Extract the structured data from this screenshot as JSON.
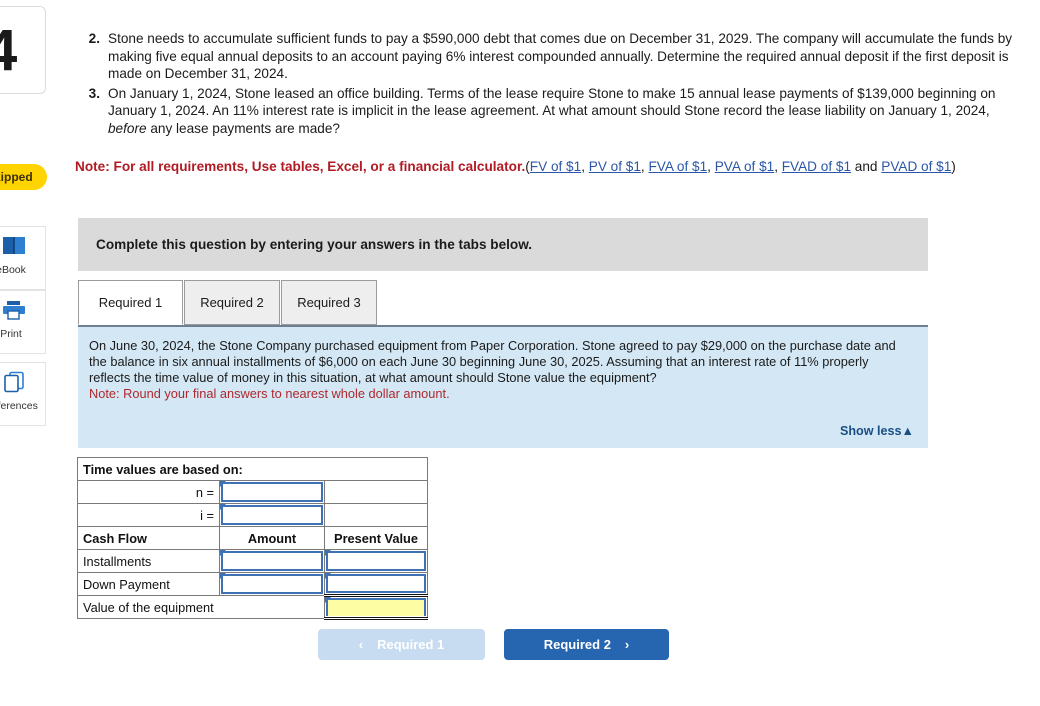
{
  "left_rail": {
    "question_number": "4",
    "status_badge": "Skipped",
    "tools": [
      {
        "icon": "ebook-icon",
        "label": "eBook"
      },
      {
        "icon": "print-icon",
        "label": "Print"
      },
      {
        "icon": "references-icon",
        "label": "References"
      }
    ]
  },
  "requirements": [
    {
      "number": "2.",
      "text_before_em": "Stone needs to accumulate sufficient funds to pay a $590,000 debt that comes due on December 31, 2029. The company will accumulate the funds by making five equal annual deposits to an account paying 6% interest compounded annually. Determine the required annual deposit if the first deposit is made on December 31, 2024.",
      "em": "",
      "text_after_em": ""
    },
    {
      "number": "3.",
      "text_before_em": "On January 1, 2024, Stone leased an office building. Terms of the lease require Stone to make 15 annual lease payments of $139,000 beginning on January 1, 2024. An 11% interest rate is implicit in the lease agreement. At what amount should Stone record the lease liability on January 1, 2024, ",
      "em": "before",
      "text_after_em": " any lease payments are made?"
    }
  ],
  "note": {
    "bold_text": "Note: For all requirements, Use tables, Excel, or a financial calculator.",
    "open_paren": "(",
    "links": [
      "FV of $1",
      "PV of $1",
      "FVA of $1",
      "PVA of $1",
      "FVAD of $1",
      "PVAD of $1"
    ],
    "separator": ", ",
    "conjunction": " and ",
    "close_paren": ")"
  },
  "gray_banner": {
    "text": "Complete this question by entering your answers in the tabs below."
  },
  "tabs": [
    {
      "label": "Required 1",
      "active": true
    },
    {
      "label": "Required 2",
      "active": false
    },
    {
      "label": "Required 3",
      "active": false
    }
  ],
  "info_panel": {
    "body": "On June 30, 2024, the Stone Company purchased equipment from Paper Corporation. Stone agreed to pay $29,000 on the purchase date and the balance in six annual installments of $6,000 on each June 30 beginning June 30, 2025. Assuming that an interest rate of 11% properly reflects the time value of money in this situation, at what amount should Stone value the equipment?",
    "note": "Note: Round your final answers to nearest whole dollar amount.",
    "show_less": "Show less",
    "show_less_arrow": "▲"
  },
  "answer_table": {
    "title_row": "Time values are based on:",
    "param_rows": [
      {
        "label": "n =",
        "value": ""
      },
      {
        "label": "i =",
        "value": ""
      }
    ],
    "column_headers": [
      "Cash Flow",
      "Amount",
      "Present Value"
    ],
    "rows": [
      {
        "label": "Installments",
        "amount": "",
        "present_value": ""
      },
      {
        "label": "Down Payment",
        "amount": "",
        "present_value": ""
      }
    ],
    "total_row": {
      "label": "Value of the equipment",
      "value": ""
    }
  },
  "nav": {
    "prev_label": "Required 1",
    "prev_icon": "‹",
    "next_label": "Required 2",
    "next_icon": "›"
  },
  "colors": {
    "table_header_blue": "#7aa5db",
    "input_border_blue": "#3f72b5",
    "answer_yellow": "#fdfda3",
    "panel_blue": "#d3e7f5",
    "primary_button": "#2666b0",
    "disabled_button": "#c7dcf0",
    "note_red": "#b01b24",
    "link_blue": "#2b56a8",
    "badge_yellow": "#ffd400"
  }
}
